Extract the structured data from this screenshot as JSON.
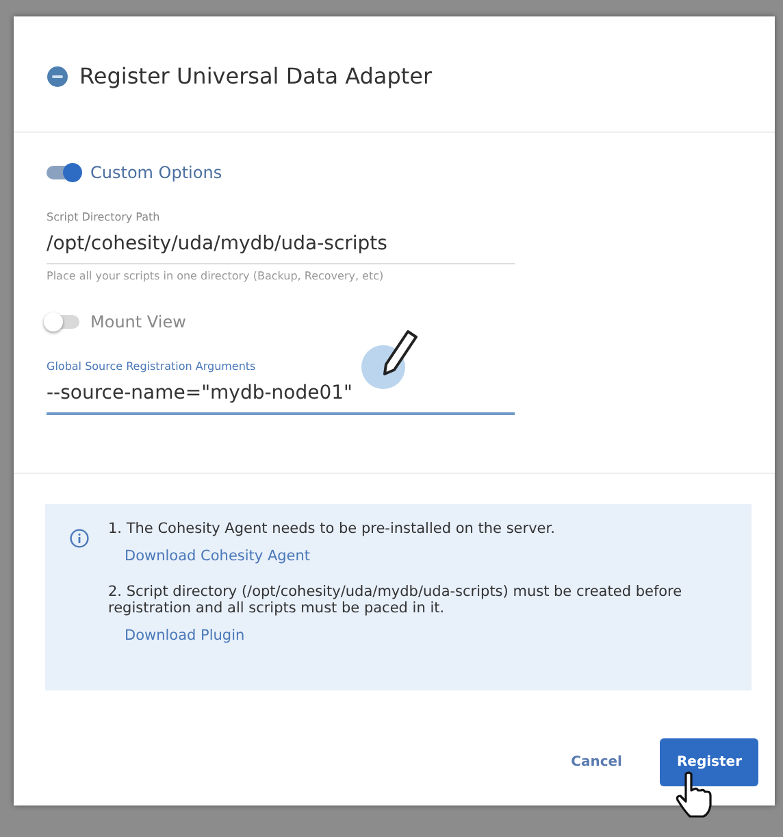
{
  "dialog": {
    "title": "Register Universal Data Adapter",
    "fields": [
      {
        "kind": "toggle",
        "label": "Custom Options",
        "on": true
      },
      {
        "kind": "text",
        "label": "Script Directory Path",
        "value": "/opt/cohesity/uda/mydb/uda-scripts",
        "hint": "Place all your scripts in one directory (Backup, Recovery, etc)",
        "focused": false
      },
      {
        "kind": "toggle",
        "label": "Mount View",
        "on": false
      },
      {
        "kind": "text",
        "label": "Global Source Registration Arguments",
        "value": "--source-name=\"mydb-node01\"",
        "focused": true
      }
    ],
    "notes": [
      {
        "text": "1. The Cohesity Agent needs to be pre-installed on the server.",
        "link": "Download Cohesity Agent"
      },
      {
        "text": "2. Script directory (/opt/cohesity/uda/mydb/uda-scripts) must be created before registration and all scripts must be paced in it.",
        "link": "Download Plugin"
      }
    ],
    "buttons": [
      {
        "label": "Cancel",
        "kind": "text"
      },
      {
        "label": "Register",
        "kind": "primary"
      }
    ]
  }
}
